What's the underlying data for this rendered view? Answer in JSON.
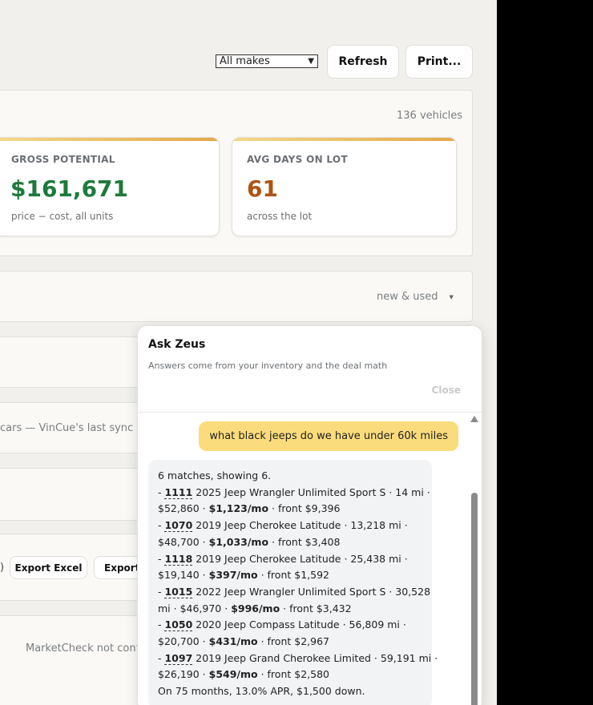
{
  "toolbar": {
    "makes_select": "All makes",
    "refresh_label": "Refresh",
    "print_label": "Print..."
  },
  "summary": {
    "vehicle_count": "136 vehicles",
    "kpis": [
      {
        "label": "GROSS POTENTIAL",
        "value": "$161,671",
        "sub": "price − cost, all units",
        "color": "#1d7a3a"
      },
      {
        "label": "AVG DAYS ON LOT",
        "value": "61",
        "sub": "across the lot",
        "color": "#b05413"
      }
    ]
  },
  "filter": {
    "condition": "new & used"
  },
  "sync_text": "cars — VinCue's last sync —",
  "export": {
    "paren": ")",
    "excel_label": "Export Excel",
    "export_label": "Export"
  },
  "marketcheck_text": "MarketCheck not confi",
  "chat": {
    "title": "Ask Zeus",
    "subtitle": "Answers come from your inventory and the deal math",
    "close_label": "Close",
    "user_message": "what black jeeps do we have under 60k miles",
    "bot": {
      "intro": "6 matches, showing 6.",
      "items": [
        {
          "stock": "1111",
          "desc": "2025 Jeep Wrangler Unlimited Sport S · 14 mi ·",
          "price": "$52,860 ·",
          "monthly": "$1,123/mo",
          "front": "· front $9,396"
        },
        {
          "stock": "1070",
          "desc": "2019 Jeep Cherokee Latitude · 13,218 mi ·",
          "price": "$48,700 ·",
          "monthly": "$1,033/mo",
          "front": "· front $3,408"
        },
        {
          "stock": "1118",
          "desc": "2019 Jeep Cherokee Latitude · 25,438 mi ·",
          "price": "$19,140 ·",
          "monthly": "$397/mo",
          "front": "· front $1,592"
        },
        {
          "stock": "1015",
          "desc": "2022 Jeep Wrangler Unlimited Sport S · 30,528",
          "price": "mi · $46,970 ·",
          "monthly": "$996/mo",
          "front": "· front $3,432"
        },
        {
          "stock": "1050",
          "desc": "2020 Jeep Compass Latitude · 56,809 mi ·",
          "price": "$20,700 ·",
          "monthly": "$431/mo",
          "front": "· front $2,967"
        },
        {
          "stock": "1097",
          "desc": "2019 Jeep Grand Cherokee Limited · 59,191 mi ·",
          "price": "$26,190 ·",
          "monthly": "$549/mo",
          "front": "· front $2,580"
        }
      ],
      "terms": "On 75 months, 13.0% APR, $1,500 down."
    }
  }
}
